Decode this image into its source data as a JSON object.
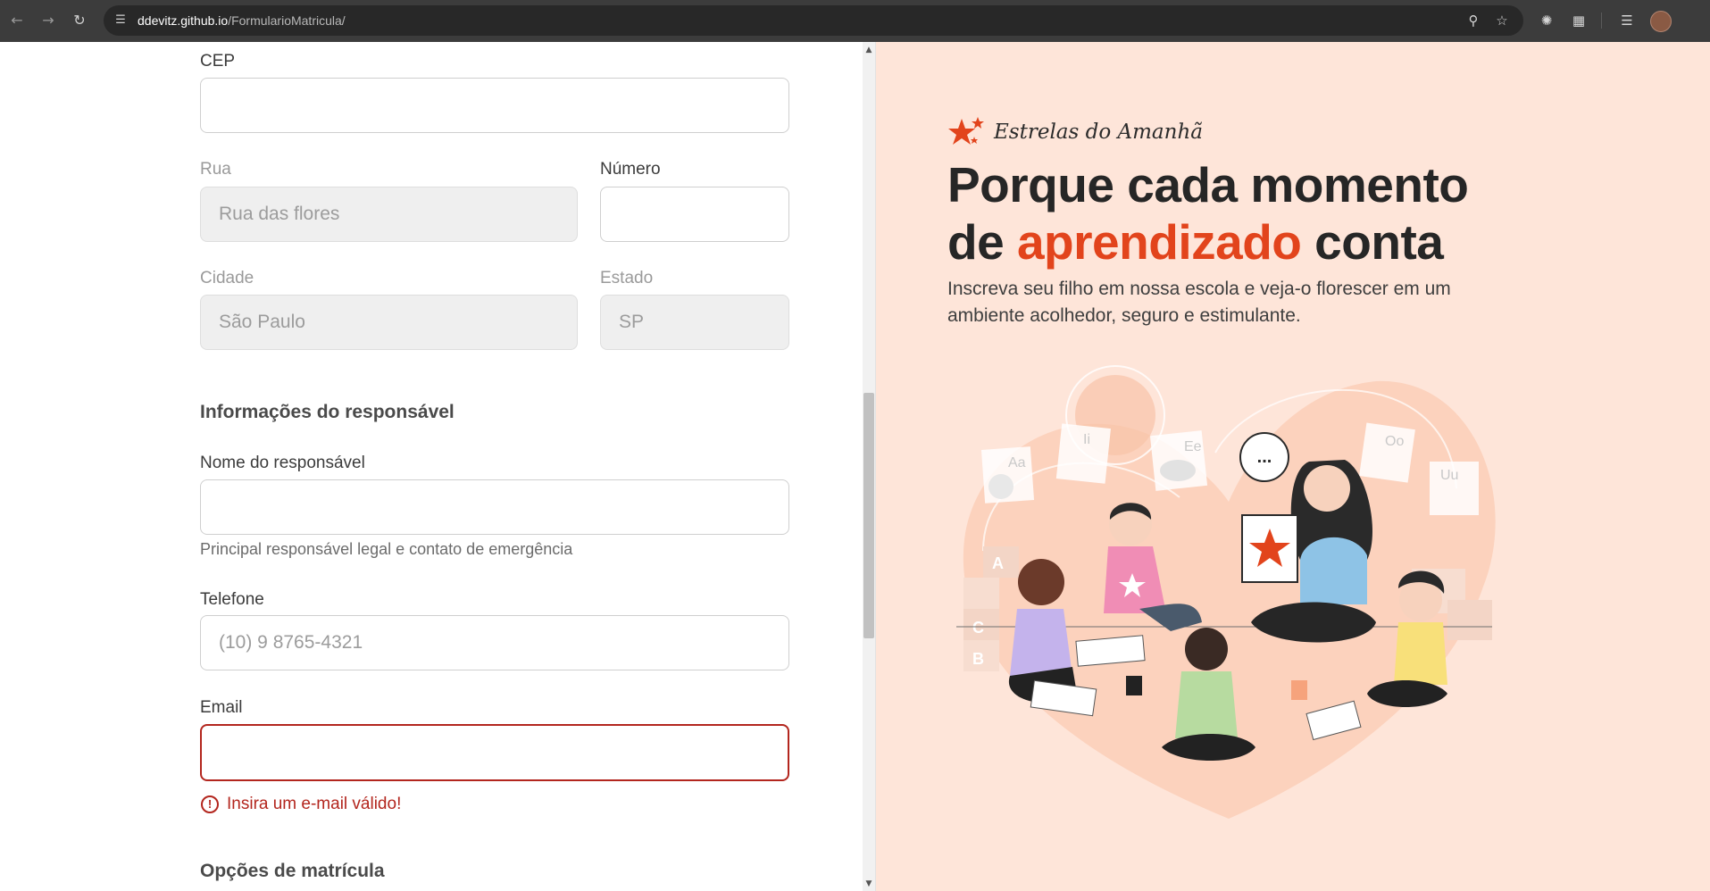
{
  "browser": {
    "url_host": "ddevitz.github.io",
    "url_path": "/FormularioMatricula/"
  },
  "form": {
    "cep": {
      "label": "CEP",
      "value": ""
    },
    "rua": {
      "label": "Rua",
      "placeholder": "Rua das flores"
    },
    "numero": {
      "label": "Número",
      "value": ""
    },
    "cidade": {
      "label": "Cidade",
      "placeholder": "São Paulo"
    },
    "estado": {
      "label": "Estado",
      "placeholder": "SP"
    },
    "responsavel_section": {
      "title": "Informações do responsável"
    },
    "nome_responsavel": {
      "label": "Nome do responsável",
      "value": "",
      "helper": "Principal responsável legal e contato de emergência"
    },
    "telefone": {
      "label": "Telefone",
      "placeholder": "(10) 9 8765-4321"
    },
    "email": {
      "label": "Email",
      "value": "",
      "error": "Insira um e-mail válido!",
      "error_icon": "!"
    },
    "opcoes_section": {
      "title": "Opções de matrícula"
    }
  },
  "hero": {
    "brand_name": "Estrelas do Amanhã",
    "headline_line1": "Porque cada momento",
    "headline_pre": "de ",
    "headline_accent": "aprendizado",
    "headline_post": " conta",
    "subtitle": "Inscreva seu filho em nossa escola e veja-o florescer em um ambiente acolhedor, seguro e estimulante.",
    "accent_color": "#e2441c",
    "background_color": "#fee5d9",
    "illustration": {
      "speech_bubble": "...",
      "cards": [
        "Aa",
        "Ii",
        "Ee",
        "Oo",
        "Uu"
      ],
      "blocks": [
        "A",
        "C",
        "B"
      ]
    }
  },
  "colors": {
    "error": "#b3261e",
    "chrome_bar": "#3c3c3c"
  }
}
